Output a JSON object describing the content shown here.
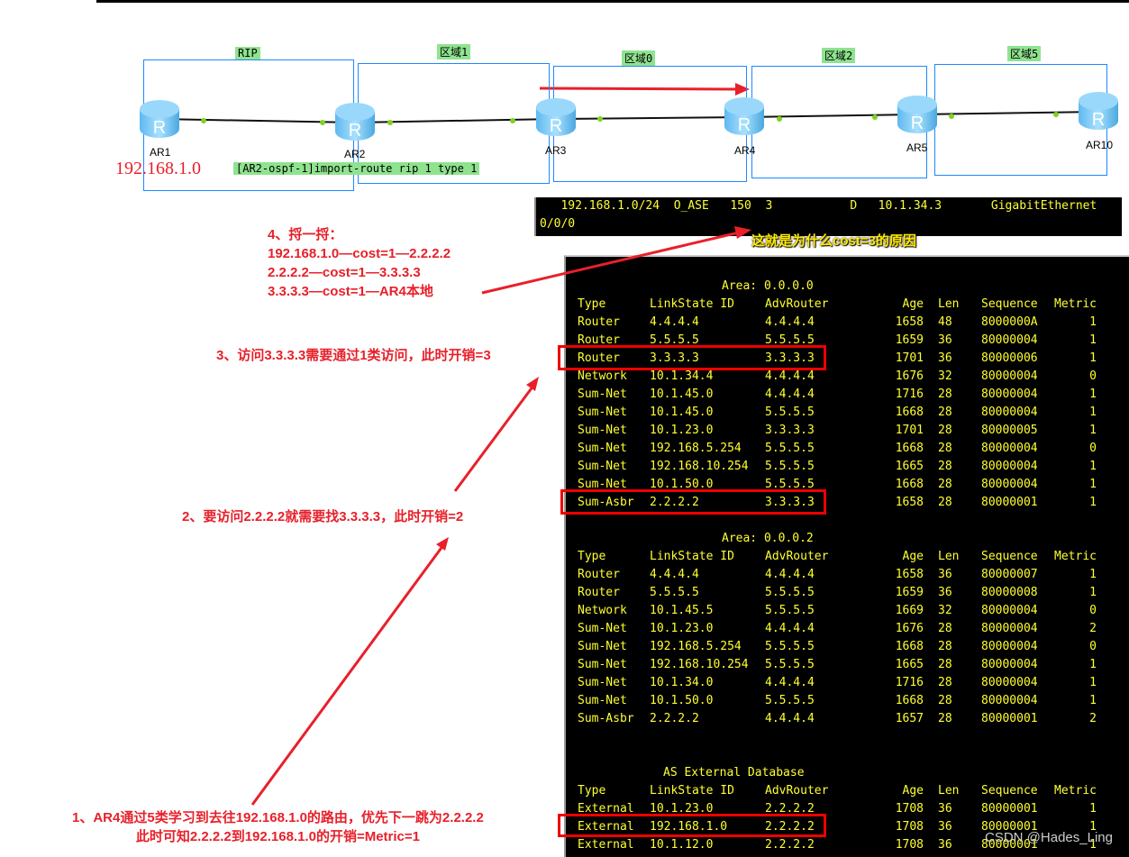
{
  "topology": {
    "zones": [
      "RIP",
      "区域1",
      "区域0",
      "区域2",
      "区域5"
    ],
    "routers": [
      "AR1",
      "AR2",
      "AR3",
      "AR4",
      "AR5",
      "AR10"
    ],
    "network_label": "192.168.1.0",
    "command": "[AR2-ospf-1]import-route rip 1 type 1"
  },
  "route": {
    "line1": "   192.168.1.0/24  O_ASE   150  3           D   10.1.34.3       GigabitEthernet",
    "line2": "0/0/0",
    "caption": "这就是为什么cost=3的原因"
  },
  "lsdb": {
    "headers": [
      "Type",
      "LinkState ID",
      "AdvRouter",
      "Age",
      "Len",
      "Sequence",
      "Metric"
    ],
    "area0_title": "Area: 0.0.0.0",
    "area0": [
      [
        "Router",
        "4.4.4.4",
        "4.4.4.4",
        "1658",
        "48",
        "8000000A",
        "1"
      ],
      [
        "Router",
        "5.5.5.5",
        "5.5.5.5",
        "1659",
        "36",
        "80000004",
        "1"
      ],
      [
        "Router",
        "3.3.3.3",
        "3.3.3.3",
        "1701",
        "36",
        "80000006",
        "1"
      ],
      [
        "Network",
        "10.1.34.4",
        "4.4.4.4",
        "1676",
        "32",
        "80000004",
        "0"
      ],
      [
        "Sum-Net",
        "10.1.45.0",
        "4.4.4.4",
        "1716",
        "28",
        "80000004",
        "1"
      ],
      [
        "Sum-Net",
        "10.1.45.0",
        "5.5.5.5",
        "1668",
        "28",
        "80000004",
        "1"
      ],
      [
        "Sum-Net",
        "10.1.23.0",
        "3.3.3.3",
        "1701",
        "28",
        "80000005",
        "1"
      ],
      [
        "Sum-Net",
        "192.168.5.254",
        "5.5.5.5",
        "1668",
        "28",
        "80000004",
        "0"
      ],
      [
        "Sum-Net",
        "192.168.10.254",
        "5.5.5.5",
        "1665",
        "28",
        "80000004",
        "1"
      ],
      [
        "Sum-Net",
        "10.1.50.0",
        "5.5.5.5",
        "1668",
        "28",
        "80000004",
        "1"
      ],
      [
        "Sum-Asbr",
        "2.2.2.2",
        "3.3.3.3",
        "1658",
        "28",
        "80000001",
        "1"
      ]
    ],
    "area2_title": "Area: 0.0.0.2",
    "area2": [
      [
        "Router",
        "4.4.4.4",
        "4.4.4.4",
        "1658",
        "36",
        "80000007",
        "1"
      ],
      [
        "Router",
        "5.5.5.5",
        "5.5.5.5",
        "1659",
        "36",
        "80000008",
        "1"
      ],
      [
        "Network",
        "10.1.45.5",
        "5.5.5.5",
        "1669",
        "32",
        "80000004",
        "0"
      ],
      [
        "Sum-Net",
        "10.1.23.0",
        "4.4.4.4",
        "1676",
        "28",
        "80000004",
        "2"
      ],
      [
        "Sum-Net",
        "192.168.5.254",
        "5.5.5.5",
        "1668",
        "28",
        "80000004",
        "0"
      ],
      [
        "Sum-Net",
        "192.168.10.254",
        "5.5.5.5",
        "1665",
        "28",
        "80000004",
        "1"
      ],
      [
        "Sum-Net",
        "10.1.34.0",
        "4.4.4.4",
        "1716",
        "28",
        "80000004",
        "1"
      ],
      [
        "Sum-Net",
        "10.1.50.0",
        "5.5.5.5",
        "1668",
        "28",
        "80000004",
        "1"
      ],
      [
        "Sum-Asbr",
        "2.2.2.2",
        "4.4.4.4",
        "1657",
        "28",
        "80000001",
        "2"
      ]
    ],
    "ext_title": "AS External Database",
    "ext": [
      [
        "External",
        "10.1.23.0",
        "2.2.2.2",
        "1708",
        "36",
        "80000001",
        "1"
      ],
      [
        "External",
        "192.168.1.0",
        "2.2.2.2",
        "1708",
        "36",
        "80000001",
        "1"
      ],
      [
        "External",
        "10.1.12.0",
        "2.2.2.2",
        "1708",
        "36",
        "80000001",
        "1"
      ]
    ]
  },
  "notes": {
    "n4": "4、捋一捋：\n192.168.1.0—cost=1—2.2.2.2\n2.2.2.2—cost=1—3.3.3.3\n3.3.3.3—cost=1—AR4本地",
    "n3": "3、访问3.3.3.3需要通过1类访问，此时开销=3",
    "n2": "2、要访问2.2.2.2就需要找3.3.3.3，此时开销=2",
    "n1": "1、AR4通过5类学习到去往192.168.1.0的路由，优先下一跳为2.2.2.2\n此时可知2.2.2.2到192.168.1.0的开销=Metric=1"
  },
  "watermark": "CSDN @Hades_Ling",
  "colors": {
    "annotation": "#e8202a",
    "terminal_text": "#ffff33",
    "zone_border": "#1e88ff",
    "zone_tag": "#8fe38f"
  }
}
